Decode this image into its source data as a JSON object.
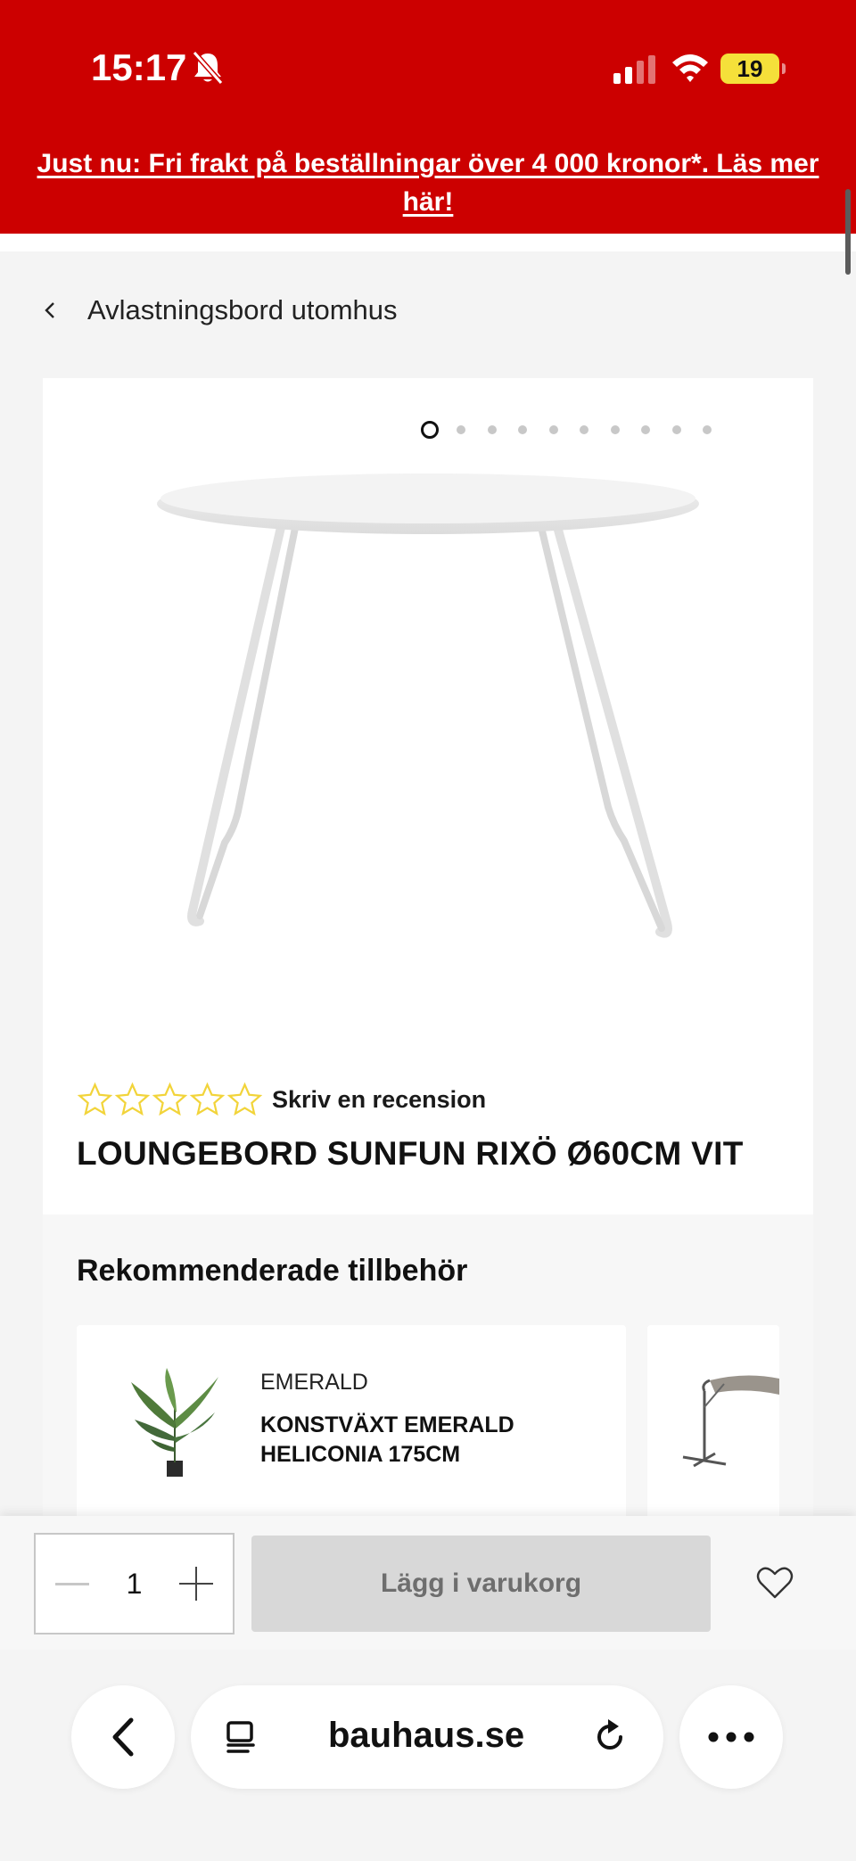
{
  "status_bar": {
    "time": "15:17",
    "battery": "19"
  },
  "promo": {
    "text": "Just nu: Fri frakt på beställningar över 4 000 kronor*. Läs mer här!"
  },
  "breadcrumb": {
    "label": "Avlastningsbord utomhus"
  },
  "gallery": {
    "dot_count": 10,
    "active_index": 0
  },
  "product": {
    "rating": 0,
    "max_rating": 5,
    "review_link": "Skriv en recension",
    "title": "LOUNGEBORD SUNFUN RIXÖ Ø60CM VIT"
  },
  "recommended": {
    "title": "Rekommenderade tillbehör",
    "items": [
      {
        "brand": "EMERALD",
        "name": "KONSTVÄXT EMERALD HELICONIA 175CM",
        "icon": "plant-image"
      },
      {
        "brand": "",
        "name": "",
        "icon": "umbrella-image"
      }
    ]
  },
  "cart": {
    "quantity": "1",
    "add_label": "Lägg i varukorg"
  },
  "browser": {
    "url": "bauhaus.se"
  },
  "colors": {
    "brand_red": "#cc0000",
    "star_yellow": "#f2d43a",
    "button_disabled": "#d8d8d8"
  }
}
